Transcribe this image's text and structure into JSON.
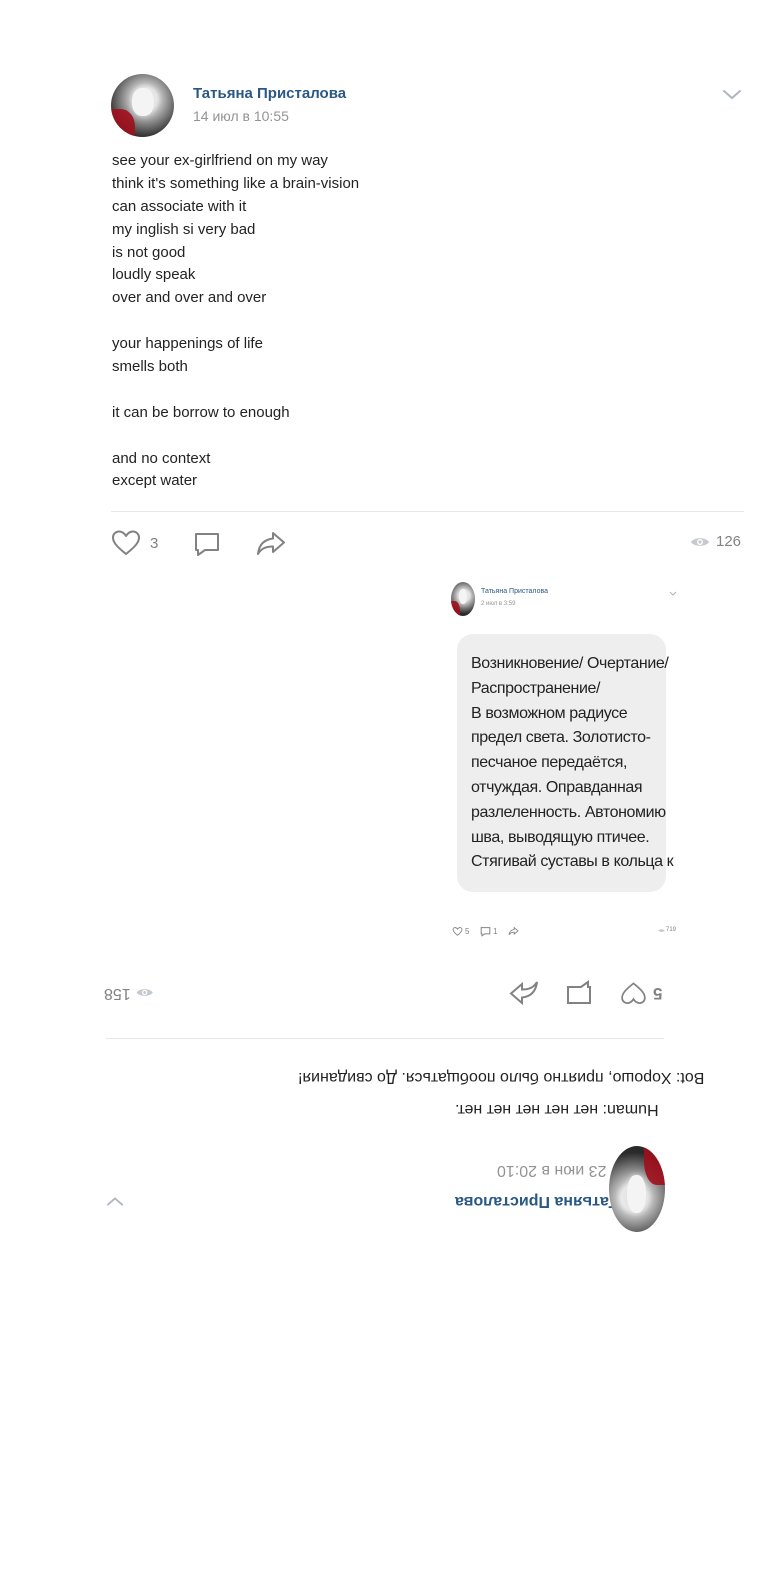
{
  "post": {
    "author": "Татьяна Присталова",
    "date": "14 июл в 10:55",
    "lines": [
      "see your ex-girlfriend on my way",
      "think it's something like a brain-vision",
      "can associate with it",
      "my inglish si very bad",
      "is not good",
      "loudly speak",
      "over and over and over",
      "",
      "your happenings of life",
      "smells both",
      "",
      "it can be borrow to enough",
      "",
      "and no context",
      "except water"
    ],
    "likes": "3",
    "views": "126",
    "icons": {
      "like": "heart-icon",
      "comment": "comment-icon",
      "share": "share-icon",
      "views": "eye-icon",
      "menu": "chevron-down-icon"
    }
  },
  "embedded": {
    "author": "Татьяна Присталова",
    "date": "2 июл в 3:59",
    "lines": [
      "Возникновение/ Очертание/",
      "Распространение/",
      "В возможном радиусе",
      "предел света. Золотисто-",
      "песчаное передаётся,",
      "отчуждая. Оправданная",
      "разлеленность. Автономию",
      "шва, выводящую птичее.",
      "Стягивай суставы в кольца к"
    ],
    "likes": "5",
    "comments": "1",
    "views": "719"
  },
  "flipped_post": {
    "author": "Татьяна Присталова",
    "date": "23 июн в 20:10",
    "line1": "Human: нет нет нет нет нет.",
    "line2": "Bot: Хорошо, приятно было пообщаться. До свидания!",
    "likes": "5",
    "views": "158"
  },
  "colors": {
    "link": "#2a5885",
    "muted": "#939393",
    "icon": "#828282",
    "divider": "#e7e8ec",
    "bubble": "#eeeeee"
  }
}
